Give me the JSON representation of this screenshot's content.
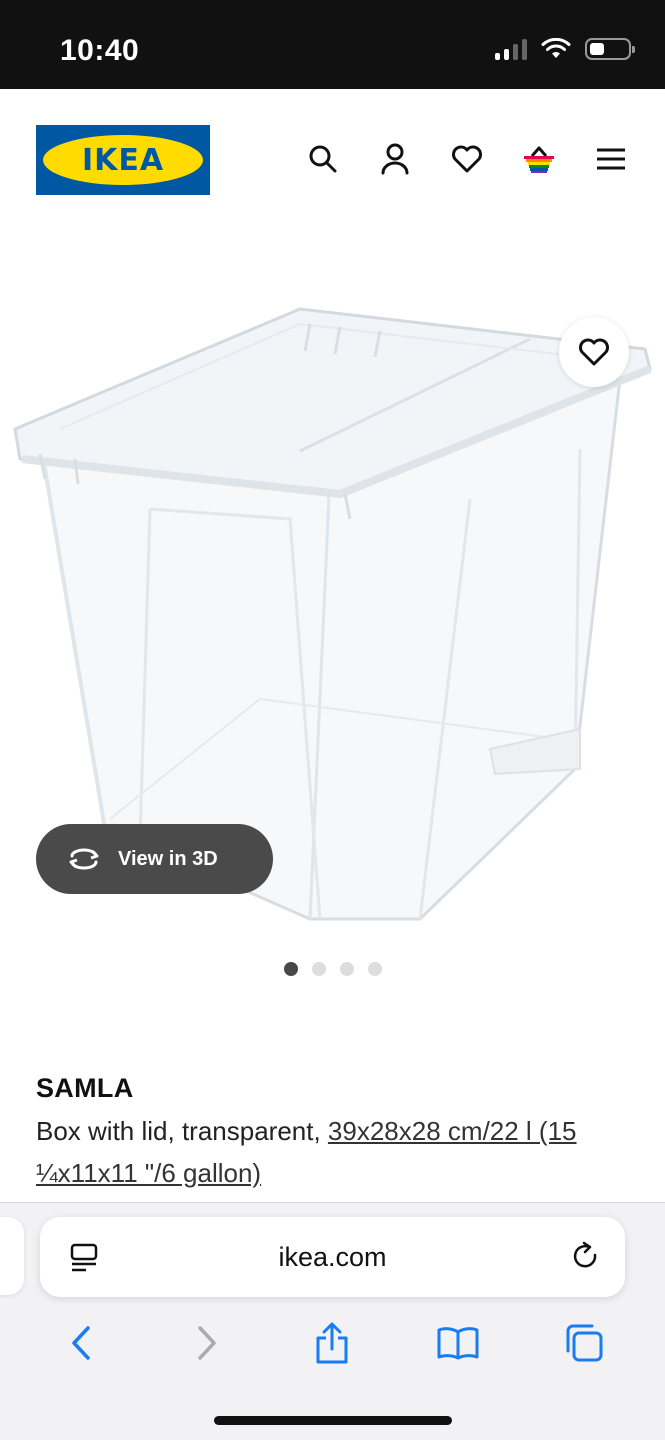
{
  "status_bar": {
    "time": "10:40"
  },
  "header": {
    "logo_text": "IKEA",
    "icons": [
      "search-icon",
      "account-icon",
      "heart-icon",
      "basket-icon",
      "menu-icon"
    ],
    "brand_colors": {
      "blue": "#0058a3",
      "yellow": "#ffdb00"
    }
  },
  "gallery": {
    "view_3d_label": "View in 3D",
    "total_images": 4,
    "active_index": 0
  },
  "product": {
    "name": "SAMLA",
    "description_prefix": "Box with lid, transparent, ",
    "size_link": "39x28x28 cm/22 l (15 ¼x11x11 \"/6 gallon)"
  },
  "browser": {
    "url": "ikea.com"
  }
}
